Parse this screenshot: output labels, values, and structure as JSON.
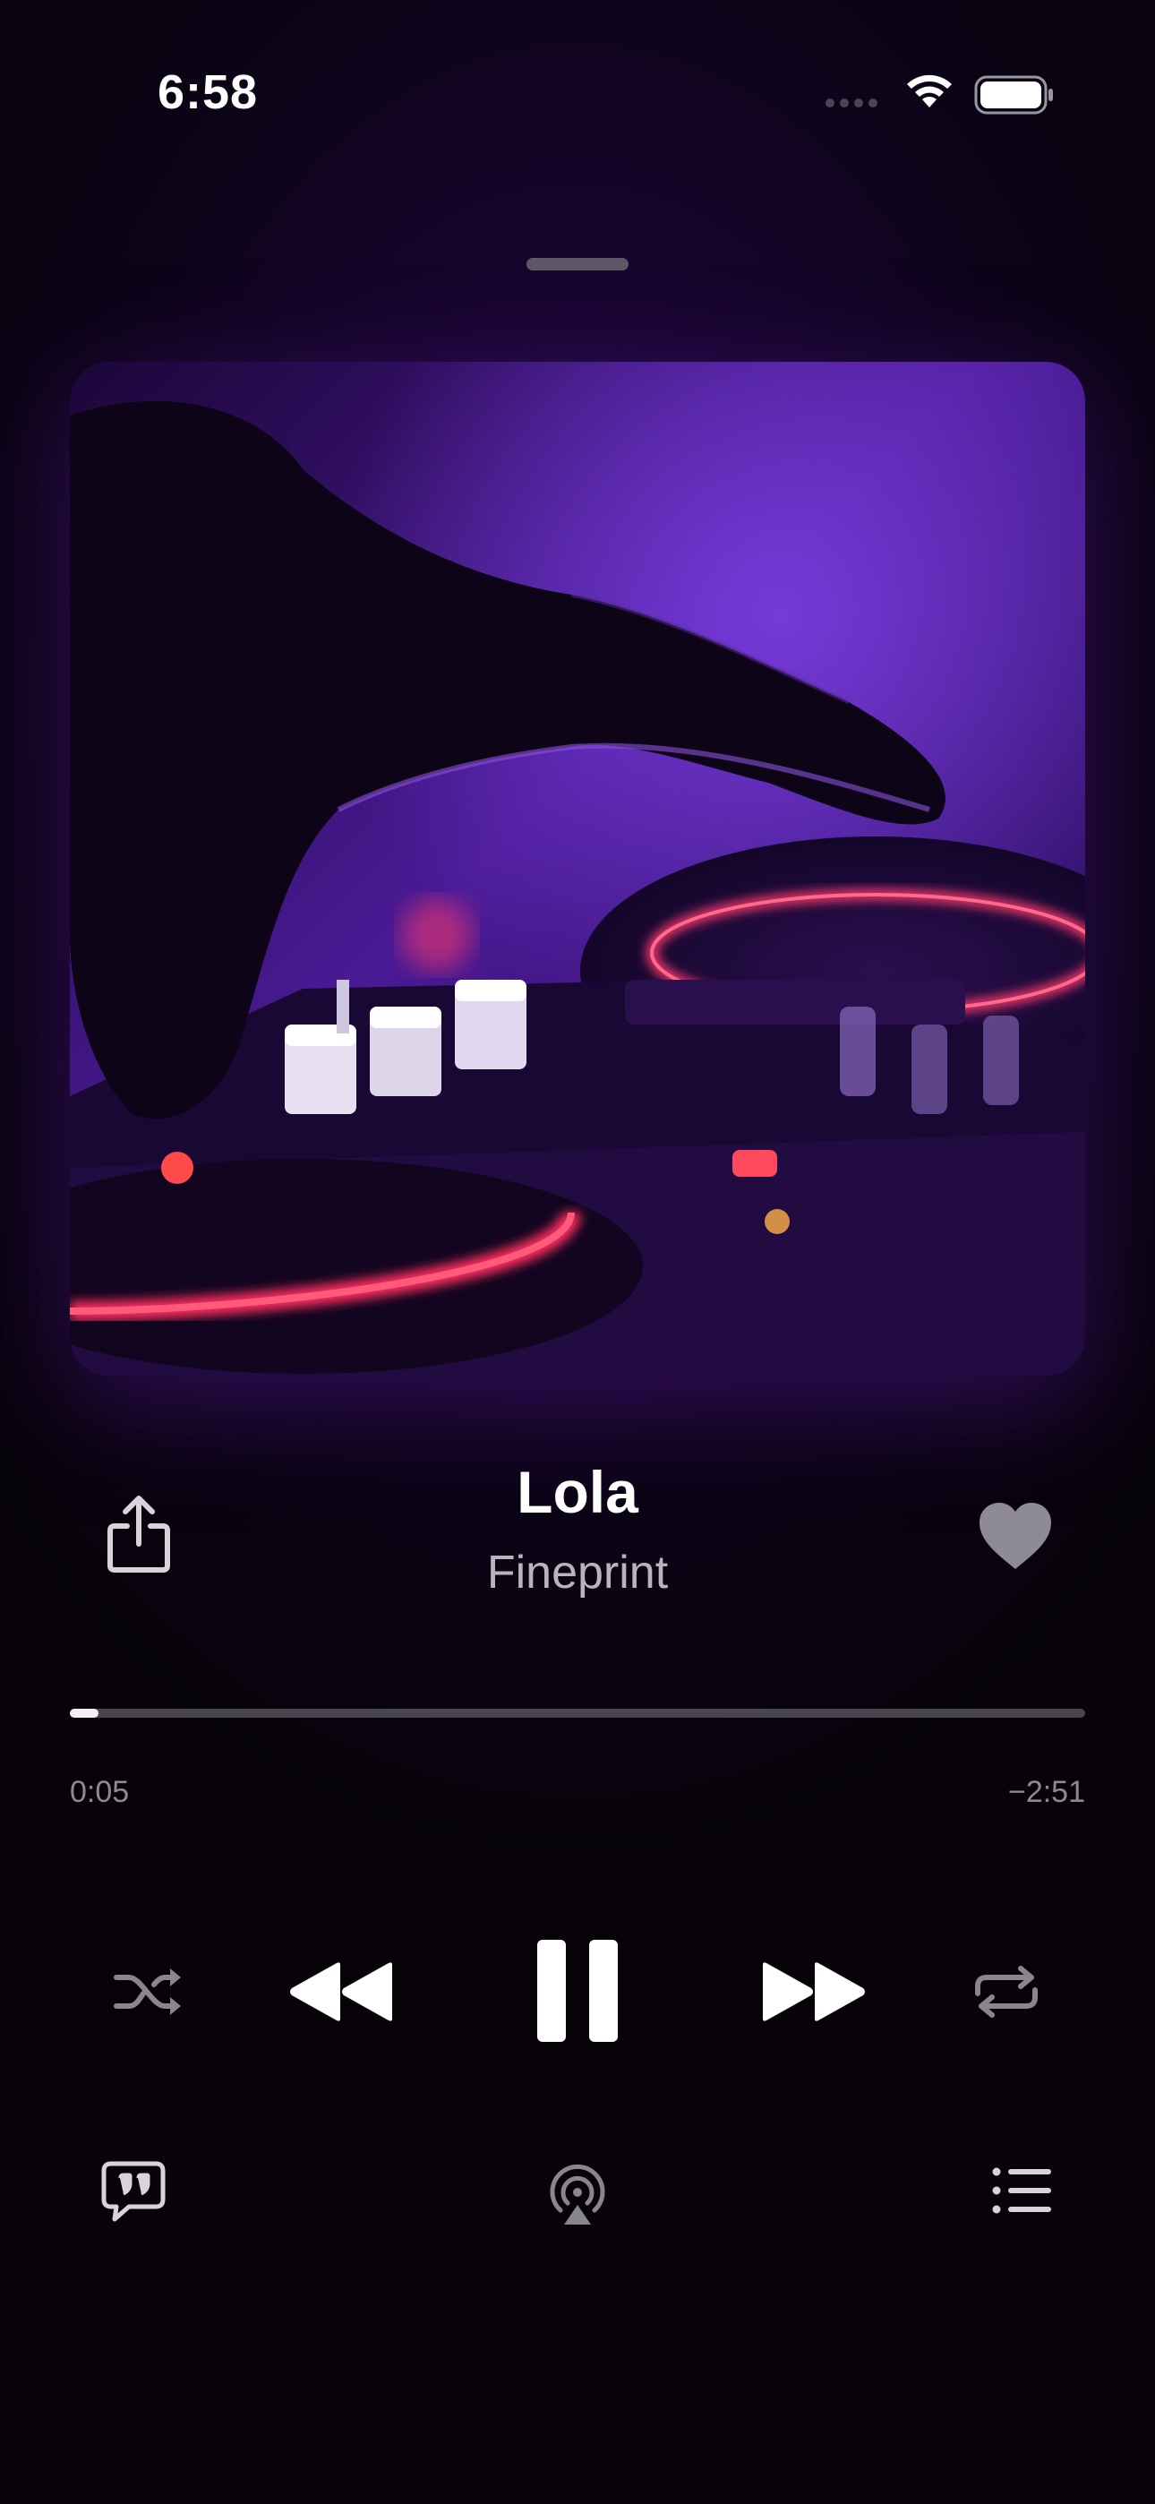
{
  "status_bar": {
    "time": "6:58",
    "icons": [
      "cellular-signal-icon",
      "wifi-icon",
      "battery-icon"
    ]
  },
  "artwork": {
    "description_icon": "album-artwork",
    "accent_colors": [
      "#5b1fa8",
      "#ff3a6e",
      "#1a0530"
    ]
  },
  "track": {
    "title": "Lola",
    "artist": "Fineprint",
    "favorited": true
  },
  "progress": {
    "elapsed": "0:05",
    "remaining": "−2:51",
    "fraction": 0.028
  },
  "controls": {
    "primary": [
      "shuffle-icon",
      "rewind-icon",
      "pause-icon",
      "fast-forward-icon",
      "repeat-icon"
    ],
    "secondary": [
      "lyrics-icon",
      "airplay-icon",
      "queue-list-icon"
    ]
  },
  "colors": {
    "background": "#0a0410",
    "accent": "#2a0a4a",
    "text_primary": "#ffffff",
    "text_secondary": "#b9b4c0",
    "text_muted": "#8d8894",
    "icon_muted": "#8a8690"
  }
}
